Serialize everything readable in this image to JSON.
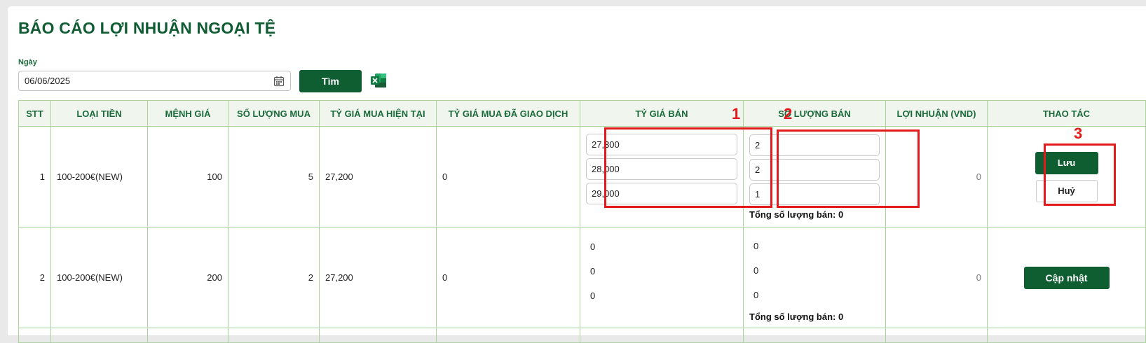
{
  "page": {
    "title": "BÁO CÁO LỢI NHUẬN NGOẠI TỆ"
  },
  "filter": {
    "date_label": "Ngày",
    "date_value": "06/06/2025",
    "search_label": "Tìm",
    "calendar_icon": "calendar-icon",
    "excel_icon": "excel-export-icon"
  },
  "table": {
    "headers": [
      "STT",
      "LOẠI TIỀN",
      "MỆNH GIÁ",
      "SỐ LƯỢNG MUA",
      "TỶ GIÁ MUA HIỆN TẠI",
      "TỶ GIÁ MUA ĐÃ GIAO DỊCH",
      "TỶ GIÁ BÁN",
      "SỐ LƯỢNG BÁN",
      "LỢI NHUẬN (VND)",
      "THAO TÁC"
    ],
    "rows": [
      {
        "stt": "1",
        "currency": "100-200€(NEW)",
        "denomination": "100",
        "buy_qty": "5",
        "current_buy_rate": "27,200",
        "traded_buy_rate": "0",
        "sell_rates": [
          "27,300",
          "28,000",
          "29,000"
        ],
        "sell_qtys": [
          "2",
          "2",
          "1"
        ],
        "total_sell_label": "Tổng số lượng bán: 0",
        "profit": "0",
        "save_label": "Lưu",
        "cancel_label": "Huỷ"
      },
      {
        "stt": "2",
        "currency": "100-200€(NEW)",
        "denomination": "200",
        "buy_qty": "2",
        "current_buy_rate": "27,200",
        "traded_buy_rate": "0",
        "sell_rates": [
          "0",
          "0",
          "0"
        ],
        "sell_qtys": [
          "0",
          "0",
          "0"
        ],
        "total_sell_label": "Tổng số lượng bán: 0",
        "profit": "0",
        "update_label": "Cập nhật"
      }
    ]
  },
  "annotations": {
    "marker_1": "1",
    "marker_2": "2",
    "marker_3": "3",
    "color": "#e11b1b"
  },
  "colors": {
    "brand_green": "#0e5e31",
    "header_bg": "#f0f6ee",
    "grid_border": "#a9d59a"
  }
}
